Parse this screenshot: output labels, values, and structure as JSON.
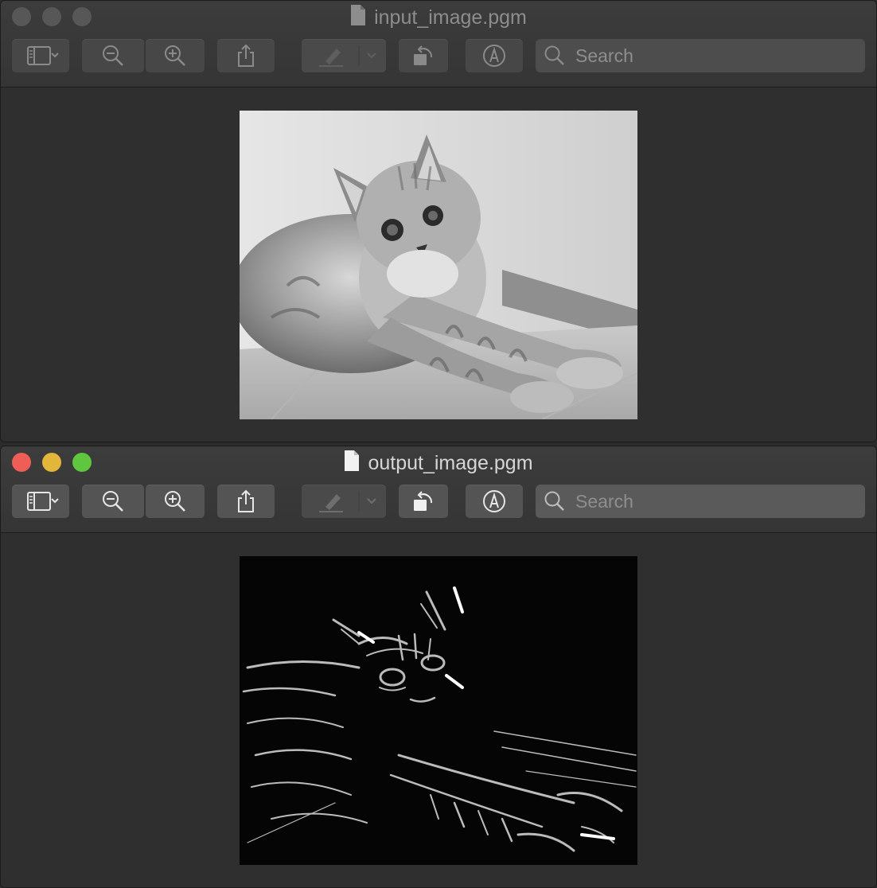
{
  "windows": [
    {
      "title": "input_image.pgm",
      "state": "inactive",
      "search_placeholder": "Search",
      "image_icon": "grayscale-kitten-photo"
    },
    {
      "title": "output_image.pgm",
      "state": "active",
      "search_placeholder": "Search",
      "image_icon": "edge-detected-kitten-photo"
    }
  ],
  "toolbar_icons": [
    "sidebar-icon",
    "chevron-down-icon",
    "zoom-out-icon",
    "zoom-in-icon",
    "share-icon",
    "markup-pen-icon",
    "rotate-icon",
    "annotate-icon",
    "search-icon"
  ],
  "colors": {
    "close": "#ee5e57",
    "minimize": "#e2b53b",
    "maximize": "#5fc63f",
    "inactive_dot": "#575757"
  }
}
